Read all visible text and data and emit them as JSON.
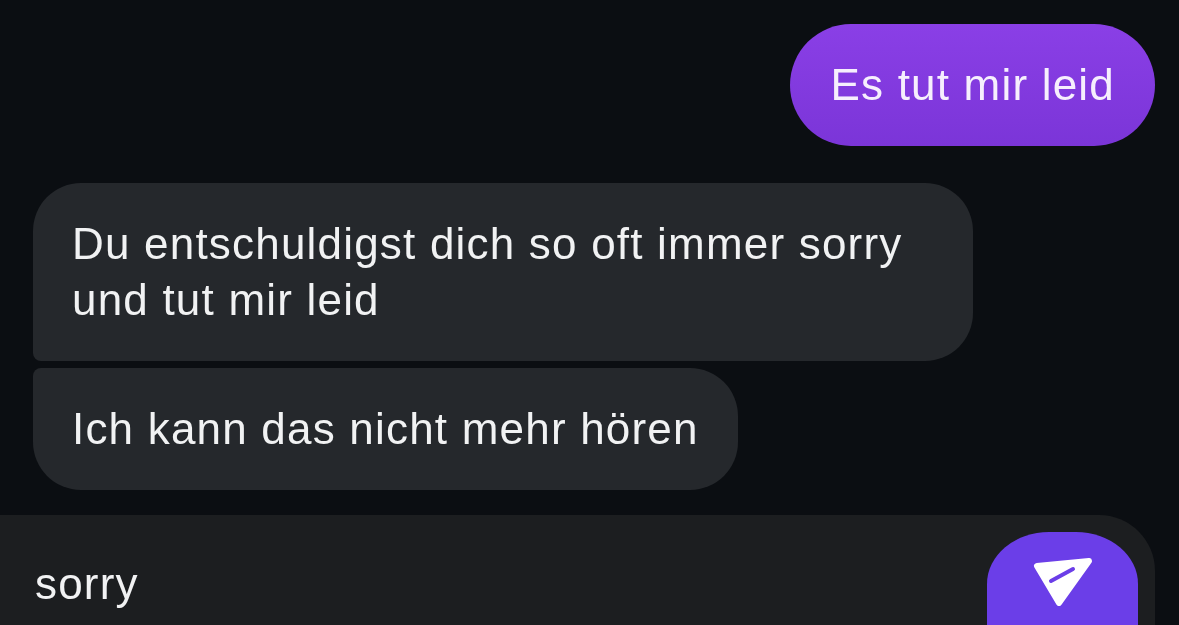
{
  "messages": [
    {
      "kind": "outgoing",
      "text": "Es tut mir leid"
    },
    {
      "kind": "incoming",
      "text": "Du entschuldigst dich so oft immer sorry und tut mir leid"
    },
    {
      "kind": "incoming",
      "text": "Ich kann das nicht mehr hören"
    }
  ],
  "composer": {
    "value": "sorry"
  }
}
